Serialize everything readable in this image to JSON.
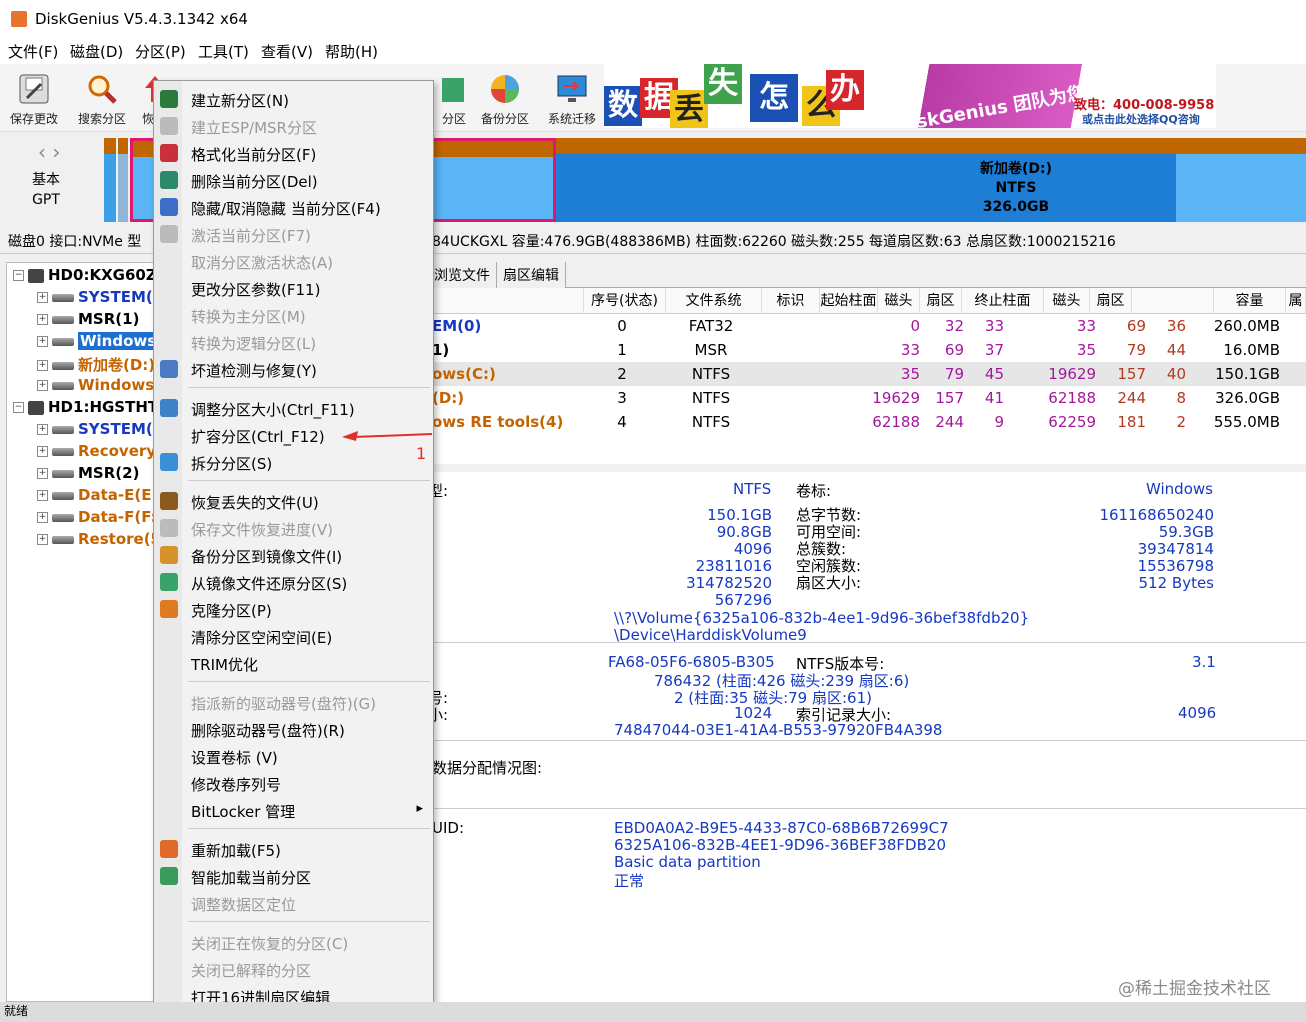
{
  "window": {
    "title": "DiskGenius V5.4.3.1342 x64"
  },
  "menubar": [
    "文件(F)",
    "磁盘(D)",
    "分区(P)",
    "工具(T)",
    "查看(V)",
    "帮助(H)"
  ],
  "toolbar": {
    "buttons": [
      "保存更改",
      "搜索分区",
      "恢",
      "分区",
      "备份分区",
      "系统迁移"
    ]
  },
  "banner": {
    "chars": [
      "数",
      "据",
      "丢",
      "失",
      "怎",
      "么",
      "办"
    ],
    "slogan": "DiskGenius 团队为您服务",
    "phone": "致电：400-008-9958",
    "qq": "或点击此处选择QQ咨询"
  },
  "diskstrip": {
    "type_line1": "基本",
    "type_line2": "GPT",
    "partition_name": "新加卷(D:)",
    "partition_fs": "NTFS",
    "partition_size": "326.0GB"
  },
  "diskinfo": "磁盘0 接口:NVMe  型",
  "diskinfo_right": "84UCKGXL  容量:476.9GB(488386MB)  柱面数:62260  磁头数:255  每道扇区数:63  总扇区数:1000215216",
  "tree": [
    {
      "label": "HD0:KXG60Z",
      "type": "disk"
    },
    {
      "label": "SYSTEM(0",
      "type": "part",
      "color": "#1638c2"
    },
    {
      "label": "MSR(1)",
      "type": "part",
      "color": "#000"
    },
    {
      "label": "Windows(",
      "type": "part",
      "color": "#fff",
      "selected": true
    },
    {
      "label": "新加卷(D:)",
      "type": "part",
      "color": "#c46400"
    },
    {
      "label": "Windows",
      "type": "part",
      "color": "#c46400"
    },
    {
      "label": "HD1:HGSTHT",
      "type": "disk"
    },
    {
      "label": "SYSTEM(0",
      "type": "part",
      "color": "#1638c2"
    },
    {
      "label": "Recovery(",
      "type": "part",
      "color": "#c46400"
    },
    {
      "label": "MSR(2)",
      "type": "part",
      "color": "#000"
    },
    {
      "label": "Data-E(E:)",
      "type": "part",
      "color": "#c46400"
    },
    {
      "label": "Data-F(F:)",
      "type": "part",
      "color": "#c46400"
    },
    {
      "label": "Restore(5",
      "type": "part",
      "color": "#c46400"
    }
  ],
  "tabs": [
    "浏览文件",
    "扇区编辑"
  ],
  "table": {
    "headers": [
      "序号(状态)",
      "文件系统",
      "标识",
      "起始柱面",
      "磁头",
      "扇区",
      "终止柱面",
      "磁头",
      "扇区",
      "容量",
      "属"
    ],
    "rows": [
      {
        "name": "EM(0)",
        "no": "0",
        "fs": "FAT32",
        "c1": "0",
        "h1": "32",
        "s1": "33",
        "c2": "33",
        "h2": "69",
        "s2": "36",
        "size": "260.0MB"
      },
      {
        "name": "1)",
        "no": "1",
        "fs": "MSR",
        "c1": "33",
        "h1": "69",
        "s1": "37",
        "c2": "35",
        "h2": "79",
        "s2": "44",
        "size": "16.0MB"
      },
      {
        "name": "ows(C:)",
        "no": "2",
        "fs": "NTFS",
        "c1": "35",
        "h1": "79",
        "s1": "45",
        "c2": "19629",
        "h2": "157",
        "s2": "40",
        "size": "150.1GB"
      },
      {
        "name": "(D:)",
        "no": "3",
        "fs": "NTFS",
        "c1": "19629",
        "h1": "157",
        "s1": "41",
        "c2": "62188",
        "h2": "244",
        "s2": "8",
        "size": "326.0GB"
      },
      {
        "name": "ows RE tools(4)",
        "no": "4",
        "fs": "NTFS",
        "c1": "62188",
        "h1": "244",
        "s1": "9",
        "c2": "62259",
        "h2": "181",
        "s2": "2",
        "size": "555.0MB"
      }
    ]
  },
  "details": {
    "fs_label": "型:",
    "fs_value": "NTFS",
    "vol_label": "卷标:",
    "vol_value": "Windows",
    "left_values": [
      "150.1GB",
      "90.8GB",
      "4096",
      "23811016",
      "314782520",
      "567296"
    ],
    "right_labels": [
      "总字节数:",
      "可用空间:",
      "总簇数:",
      "空闲簇数:",
      "扇区大小:"
    ],
    "right_values": [
      "161168650240",
      "59.3GB",
      "39347814",
      "15536798",
      "512 Bytes"
    ],
    "volume_path": "\\\\?\\Volume{6325a106-832b-4ee1-9d96-36bef38fdb20}",
    "device_path": "\\Device\\HarddiskVolume9",
    "serial": "FA68-05F6-6805-B305",
    "ntfs_ver_label": "NTFS版本号:",
    "ntfs_ver": "3.1",
    "mft": "786432 (柱面:426 磁头:239 扇区:6)",
    "mft_label": "号:",
    "mftmirr": "2 (柱面:35 磁头:79 扇区:61)",
    "rec_label": "小:",
    "rec_size": "1024",
    "idx_label": "索引记录大小:",
    "idx_size": "4096",
    "guid": "74847044-03E1-41A4-B553-97920FB4A398",
    "alloc_label": "数据分配情况图:",
    "uid_label": "UID:",
    "guid1": "EBD0A0A2-B9E5-4433-87C0-68B6B72699C7",
    "guid2": "6325A106-832B-4EE1-9D96-36BEF38FDB20",
    "ptype": "Basic data partition",
    "status": "正常"
  },
  "context_menu": [
    {
      "label": "建立新分区(N)",
      "disabled": false,
      "color": "#2b7a3b"
    },
    {
      "label": "建立ESP/MSR分区",
      "disabled": true,
      "color": "#bbb"
    },
    {
      "label": "格式化当前分区(F)",
      "disabled": false,
      "color": "#c9303a"
    },
    {
      "label": "删除当前分区(Del)",
      "disabled": false,
      "color": "#2c8a6a"
    },
    {
      "label": "隐藏/取消隐藏 当前分区(F4)",
      "disabled": false,
      "color": "#3d6fc9"
    },
    {
      "label": "激活当前分区(F7)",
      "disabled": true,
      "color": "#bbb"
    },
    {
      "label": "取消分区激活状态(A)",
      "disabled": true,
      "color": "#ccc"
    },
    {
      "label": "更改分区参数(F11)",
      "disabled": false,
      "color": "#ccc"
    },
    {
      "label": "转换为主分区(M)",
      "disabled": true,
      "color": "#ccc"
    },
    {
      "label": "转换为逻辑分区(L)",
      "disabled": true,
      "color": "#ccc"
    },
    {
      "label": "坏道检测与修复(Y)",
      "disabled": false,
      "color": "#4a7bc2"
    },
    {
      "sep": true
    },
    {
      "label": "调整分区大小(Ctrl_F11)",
      "disabled": false,
      "color": "#3b82c9"
    },
    {
      "label": "扩容分区(Ctrl_F12)",
      "disabled": false,
      "color": "#ccc"
    },
    {
      "label": "拆分分区(S)",
      "disabled": false,
      "color": "#3b8fd6"
    },
    {
      "sep": true
    },
    {
      "label": "恢复丢失的文件(U)",
      "disabled": false,
      "color": "#8a5a1e"
    },
    {
      "label": "保存文件恢复进度(V)",
      "disabled": true,
      "color": "#bbb"
    },
    {
      "label": "备份分区到镜像文件(I)",
      "disabled": false,
      "color": "#d8922a"
    },
    {
      "label": "从镜像文件还原分区(S)",
      "disabled": false,
      "color": "#3aa36a"
    },
    {
      "label": "克隆分区(P)",
      "disabled": false,
      "color": "#e07a20"
    },
    {
      "label": "清除分区空闲空间(E)",
      "disabled": false,
      "color": "#ccc"
    },
    {
      "label": "TRIM优化",
      "disabled": false,
      "color": "#ccc"
    },
    {
      "sep": true
    },
    {
      "label": "指派新的驱动器号(盘符)(G)",
      "disabled": true,
      "color": "#ccc"
    },
    {
      "label": "删除驱动器号(盘符)(R)",
      "disabled": false,
      "color": "#ccc"
    },
    {
      "label": "设置卷标 (V)",
      "disabled": false,
      "color": "#ccc"
    },
    {
      "label": "修改卷序列号",
      "disabled": false,
      "color": "#ccc"
    },
    {
      "label": "BitLocker 管理",
      "disabled": false,
      "color": "#ccc",
      "submenu": true
    },
    {
      "sep": true
    },
    {
      "label": "重新加载(F5)",
      "disabled": false,
      "color": "#e06a2a"
    },
    {
      "label": "智能加载当前分区",
      "disabled": false,
      "color": "#3a9a5a"
    },
    {
      "label": "调整数据区定位",
      "disabled": true,
      "color": "#ccc"
    },
    {
      "sep": true
    },
    {
      "label": "关闭正在恢复的分区(C)",
      "disabled": true,
      "color": "#ccc"
    },
    {
      "label": "关闭已解释的分区",
      "disabled": true,
      "color": "#ccc"
    },
    {
      "label": "打开16进制扇区编辑",
      "disabled": false,
      "color": "#ccc"
    }
  ],
  "annotation": "1",
  "watermark": "@稀土掘金技术社区",
  "status": "就绪"
}
